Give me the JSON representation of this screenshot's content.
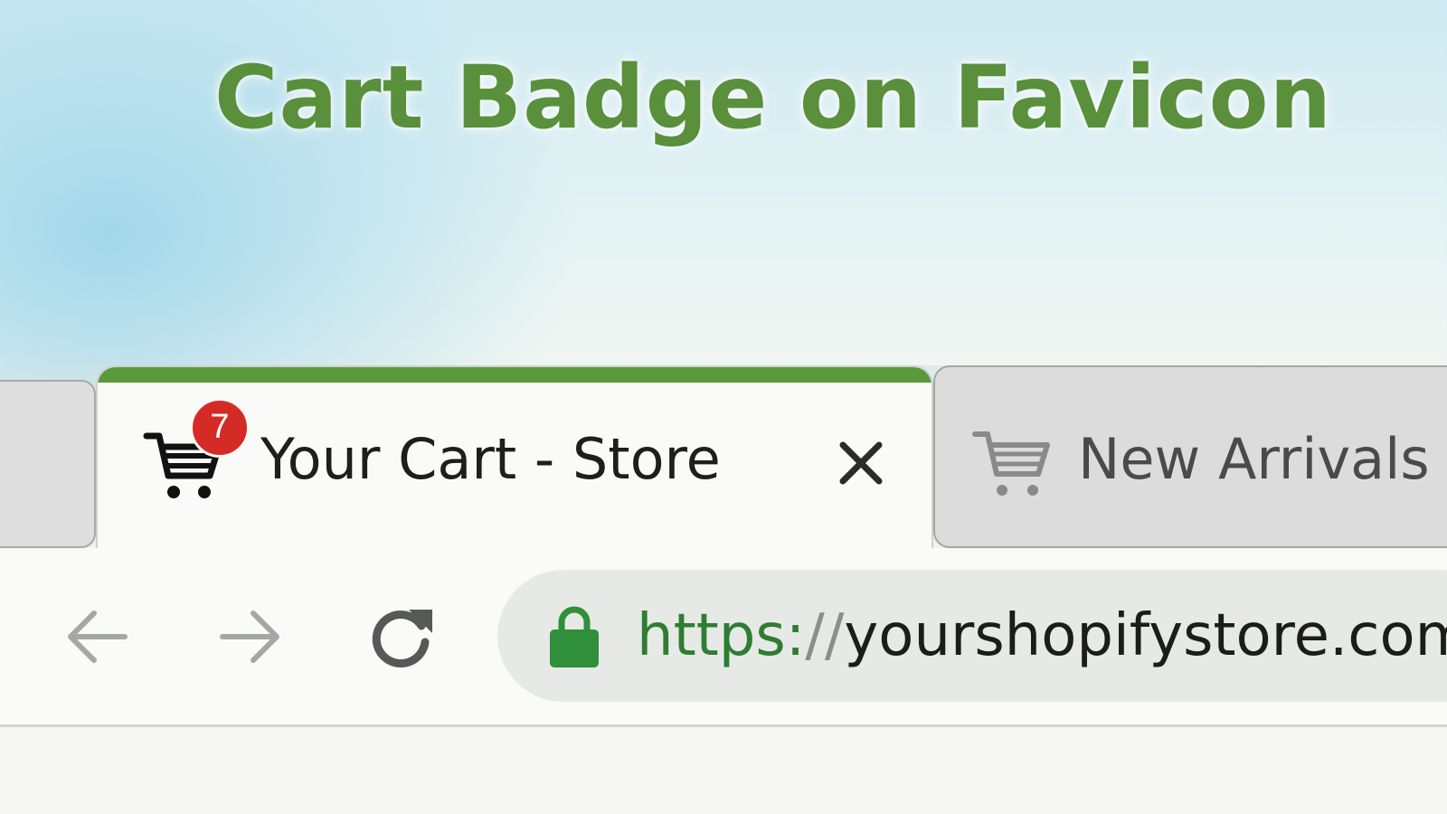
{
  "headline": "Cart Badge on Favicon",
  "colors": {
    "headline": "#5a8f3c",
    "active_tab_accent": "#5a9a3a",
    "badge": "#d52b26",
    "url_scheme": "#2f7d32",
    "lock": "#2f8f3a"
  },
  "tabs": [
    {
      "title": "Your Cart - Store",
      "favicon": "shopping-cart-icon",
      "badge_count": "7",
      "active": true
    },
    {
      "title": "New Arrivals",
      "favicon": "shopping-cart-icon",
      "active": false
    }
  ],
  "toolbar": {
    "back_icon": "arrow-left-icon",
    "forward_icon": "arrow-right-icon",
    "reload_icon": "reload-icon",
    "lock_icon": "lock-icon",
    "url_scheme": "https:",
    "url_separator": "//",
    "url_host": "yourshopifystore.com"
  }
}
